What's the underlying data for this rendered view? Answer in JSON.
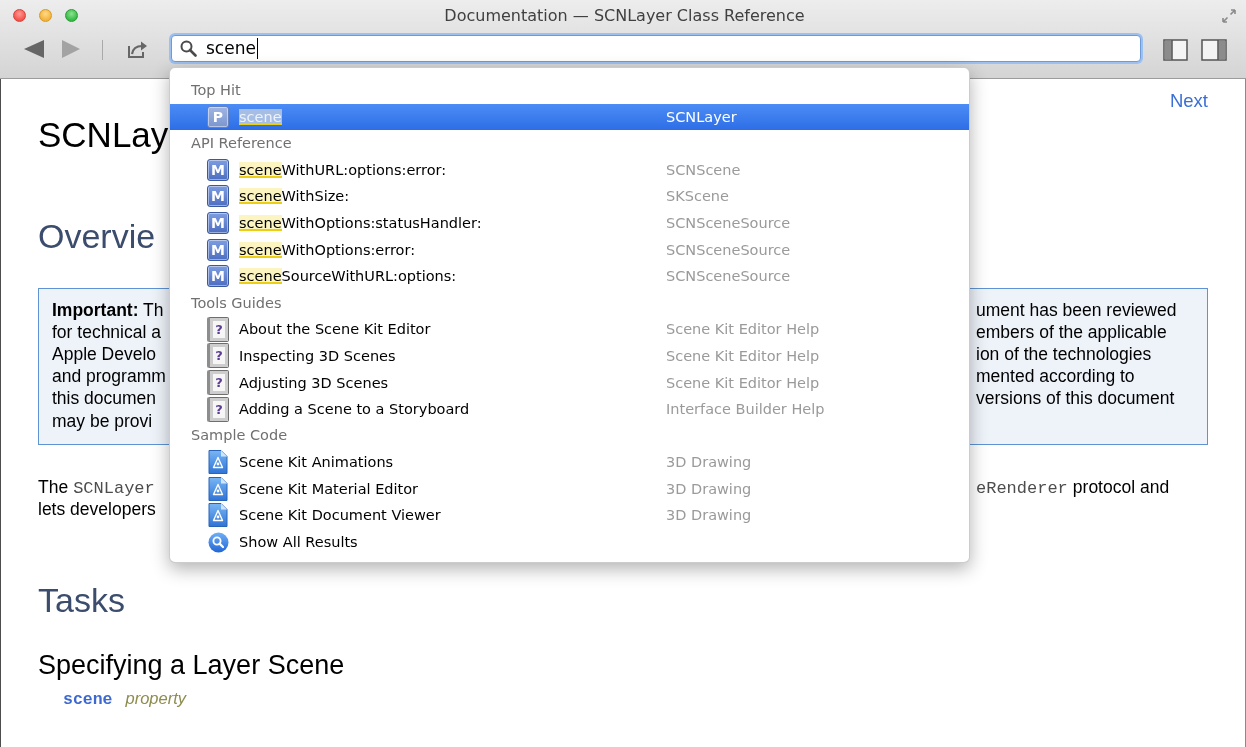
{
  "window": {
    "title": "Documentation — SCNLayer Class Reference"
  },
  "toolbar": {
    "nav": [
      {
        "kind": "back",
        "disabled": false
      },
      {
        "kind": "forward",
        "disabled": true
      }
    ],
    "search": {
      "value": "scene",
      "focused": true
    }
  },
  "results": {
    "sections": [
      {
        "heading": "Top Hit",
        "items": [
          {
            "kind": "symbol",
            "badge": "P",
            "match": "scene",
            "detail": "SCNLayer",
            "selected": true
          }
        ]
      },
      {
        "heading": "API Reference",
        "items": [
          {
            "kind": "symbol",
            "badge": "M",
            "match": "scene",
            "rest": "WithURL:options:error:",
            "detail": "SCNScene",
            "selected": false
          },
          {
            "kind": "symbol",
            "badge": "M",
            "match": "scene",
            "rest": "WithSize:",
            "detail": "SKScene",
            "selected": false
          },
          {
            "kind": "symbol",
            "badge": "M",
            "match": "scene",
            "rest": "WithOptions:statusHandler:",
            "detail": "SCNSceneSource",
            "selected": false
          },
          {
            "kind": "symbol",
            "badge": "M",
            "match": "scene",
            "rest": "WithOptions:error:",
            "detail": "SCNSceneSource",
            "selected": false
          },
          {
            "kind": "symbol",
            "badge": "M",
            "match": "scene",
            "rest": "SourceWithURL:options:",
            "detail": "SCNSceneSource",
            "selected": false
          }
        ]
      },
      {
        "heading": "Tools Guides",
        "items": [
          {
            "kind": "guide",
            "badge": "?",
            "title": "About the Scene Kit Editor",
            "detail": "Scene Kit Editor Help",
            "selected": false
          },
          {
            "kind": "guide",
            "badge": "?",
            "title": "Inspecting 3D Scenes",
            "detail": "Scene Kit Editor Help",
            "selected": false
          },
          {
            "kind": "guide",
            "badge": "?",
            "title": "Adjusting 3D Scenes",
            "detail": "Scene Kit Editor Help",
            "selected": false
          },
          {
            "kind": "guide",
            "badge": "?",
            "title": "Adding a Scene to a Storyboard",
            "detail": "Interface Builder Help",
            "selected": false
          }
        ]
      },
      {
        "heading": "Sample Code",
        "items": [
          {
            "kind": "sample",
            "title": "Scene Kit Animations",
            "detail": "3D Drawing",
            "selected": false
          },
          {
            "kind": "sample",
            "title": "Scene Kit Material Editor",
            "detail": "3D Drawing",
            "selected": false
          },
          {
            "kind": "sample",
            "title": "Scene Kit Document Viewer",
            "detail": "3D Drawing",
            "selected": false
          }
        ]
      }
    ],
    "show_all": {
      "label": "Show All Results",
      "selected": false
    }
  },
  "page": {
    "next_link": "Next",
    "title": "SCNLay",
    "overview_heading": "Overvie",
    "note_lines": [
      {
        "left": "**Important:** Th",
        "right": "ument has been reviewed"
      },
      {
        "left": "for technical a",
        "right": "embers of the applicable"
      },
      {
        "left": "Apple Develo",
        "right": "ion of the technologies"
      },
      {
        "left": "and programm",
        "right": "mented according to"
      },
      {
        "left": "this documen",
        "right": "versions of this document"
      },
      {
        "left": "may be provi"
      }
    ],
    "paragraph_lines": [
      {
        "left": [
          {
            "kind": "text",
            "text": "The"
          },
          {
            "kind": "code",
            "text": "SCNLayer"
          }
        ],
        "right": [
          {
            "kind": "code",
            "text": "eRenderer"
          },
          {
            "kind": "text",
            "text": "protocol and"
          }
        ]
      },
      {
        "left": [
          {
            "kind": "text",
            "text": "lets developers"
          }
        ]
      }
    ],
    "tasks_heading": "Tasks",
    "task_groups": [
      {
        "heading": "Specifying a Layer Scene",
        "items": [
          {
            "name": "scene",
            "type": "property"
          }
        ]
      }
    ]
  }
}
